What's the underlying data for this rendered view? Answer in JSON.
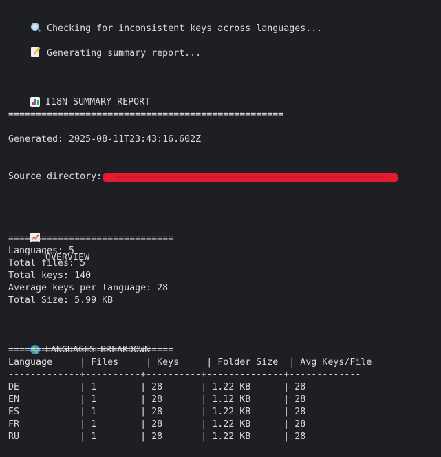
{
  "lines": {
    "checking": "Checking for inconsistent keys across languages...",
    "generating": "Generating summary report...",
    "report_title": "I18N SUMMARY REPORT",
    "title_rule": "==================================================",
    "generated": "Generated: 2025-08-11T23:43:16.602Z",
    "source_dir_label": "Source directory:",
    "overview_title": "OVERVIEW",
    "overview_rule": "==============================",
    "languages": "Languages: 5",
    "total_files": "Total files: 5",
    "total_keys": "Total keys: 140",
    "avg_keys": "Average keys per language: 28",
    "total_size": "Total Size: 5.99 KB",
    "breakdown_title": "LANGUAGES BREAKDOWN",
    "breakdown_rule": "==============================",
    "table_header": "Language     | Files     | Keys     | Folder Size  | Avg Keys/File",
    "table_separator": "-------------+----------+----------+--------------+-------------"
  },
  "icons": {
    "checking": "magnifying-glass-icon",
    "generating": "memo-icon",
    "report": "bar-chart-icon",
    "overview": "chart-increasing-icon",
    "breakdown": "globe-icon"
  },
  "colors": {
    "background": "#1e1f22",
    "text": "#d8dadf",
    "redaction": "#e5192f"
  },
  "table_rows": [
    "DE           | 1        | 28       | 1.22 KB      | 28",
    "EN           | 1        | 28       | 1.12 KB      | 28",
    "ES           | 1        | 28       | 1.22 KB      | 28",
    "FR           | 1        | 28       | 1.22 KB      | 28",
    "RU           | 1        | 28       | 1.22 KB      | 28"
  ]
}
